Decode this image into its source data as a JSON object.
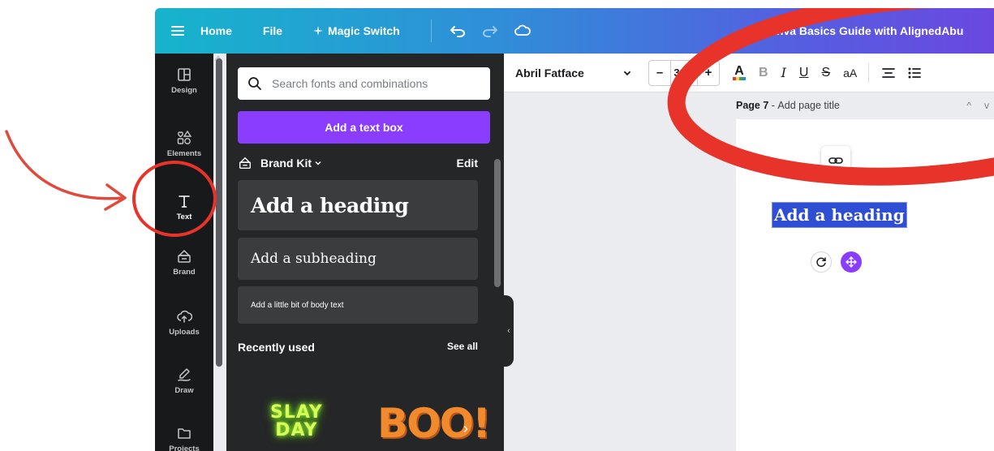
{
  "topbar": {
    "home_label": "Home",
    "file_label": "File",
    "magic_switch_label": "Magic Switch",
    "doc_title": "Canva Basics Guide with AlignedAbu",
    "icons": [
      "menu-icon",
      "sparkle-icon",
      "undo-icon",
      "redo-icon",
      "cloud-sync-icon"
    ]
  },
  "rail": {
    "items": [
      {
        "label": "Design",
        "icon": "layout-icon"
      },
      {
        "label": "Elements",
        "icon": "shapes-icon"
      },
      {
        "label": "Text",
        "icon": "text-icon"
      },
      {
        "label": "Brand",
        "icon": "brand-icon"
      },
      {
        "label": "Uploads",
        "icon": "cloud-upload-icon"
      },
      {
        "label": "Draw",
        "icon": "pen-icon"
      },
      {
        "label": "Projects",
        "icon": "folder-icon"
      }
    ],
    "active": "Text"
  },
  "panel": {
    "search_placeholder": "Search fonts and combinations",
    "add_textbox_label": "Add a text box",
    "brand_kit_label": "Brand Kit",
    "edit_label": "Edit",
    "heading_label": "Add a heading",
    "subheading_label": "Add a subheading",
    "body_label": "Add a little bit of body text",
    "recently_used_label": "Recently used",
    "see_all_label": "See all",
    "recent_items": [
      {
        "line1": "SLAY",
        "line2": "DAY"
      },
      {
        "text": "BOO!"
      }
    ]
  },
  "format_toolbar": {
    "font_name": "Abril Fatface",
    "minus_label": "–",
    "font_size": "31.5",
    "plus_label": "+",
    "text_color_label": "A",
    "bold_label": "B",
    "italic_label": "I",
    "underline_label": "U",
    "strike_label": "S",
    "case_label": "aA",
    "text_color_bar": [
      "#e53935",
      "#fdd835",
      "#43a047",
      "#1e88e5"
    ]
  },
  "page": {
    "page_number": "Page 7",
    "page_title_placeholder": "Add page title",
    "canvas_heading": "Add a heading"
  },
  "colors": {
    "accent_purple": "#8b3dff",
    "selection_blue": "#2e4fd4",
    "annotation_red": "#e8332a"
  }
}
